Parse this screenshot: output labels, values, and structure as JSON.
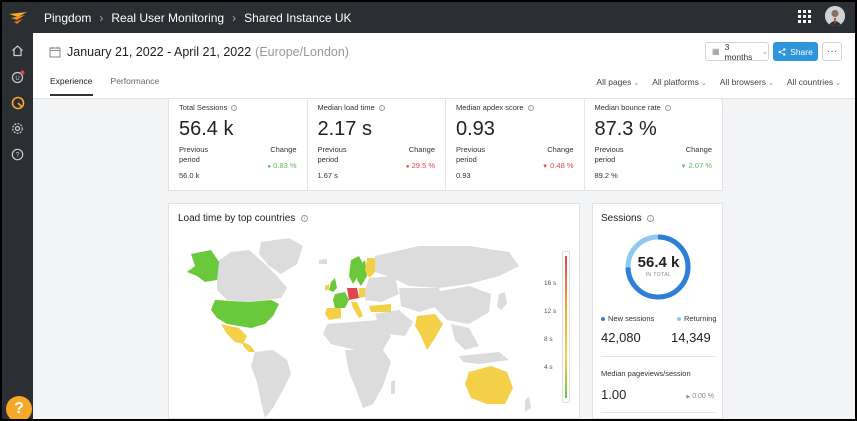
{
  "topbar": {
    "breadcrumbs": [
      "Pingdom",
      "Real User Monitoring",
      "Shared Instance UK"
    ]
  },
  "header": {
    "date_range": "January 21, 2022 - April 21, 2022",
    "timezone": "(Europe/London)",
    "period_label": "3 months",
    "share_label": "Share",
    "more_label": "···"
  },
  "tabs": [
    {
      "label": "Experience",
      "active": true
    },
    {
      "label": "Performance",
      "active": false
    }
  ],
  "filters": [
    "All pages",
    "All platforms",
    "All browsers",
    "All countries"
  ],
  "metrics": [
    {
      "title": "Total Sessions",
      "value": "56.4 k",
      "prev_label": "Previous period",
      "change_label": "Change",
      "change": "0.83 %",
      "trend": "up",
      "prev_value": "56.0 k"
    },
    {
      "title": "Median load time",
      "value": "2.17 s",
      "prev_label": "Previous period",
      "change_label": "Change",
      "change": "29.5 %",
      "trend": "up-bad",
      "prev_value": "1.67 s"
    },
    {
      "title": "Median apdex score",
      "value": "0.93",
      "prev_label": "Previous period",
      "change_label": "Change",
      "change": "0.48 %",
      "trend": "down-bad",
      "prev_value": "0.93"
    },
    {
      "title": "Median bounce rate",
      "value": "87.3 %",
      "prev_label": "Previous period",
      "change_label": "Change",
      "change": "2.07 %",
      "trend": "down-good",
      "prev_value": "89.2 %"
    }
  ],
  "map": {
    "title": "Load time by top countries",
    "legend_ticks": [
      "16 s",
      "12 s",
      "8 s",
      "4 s"
    ]
  },
  "sessions": {
    "title": "Sessions",
    "total": "56.4 k",
    "total_sub": "IN TOTAL",
    "new_label": "New sessions",
    "returning_label": "Returning",
    "new_value": "42,080",
    "returning_value": "14,349",
    "new_fraction": 0.746,
    "pageviews_label": "Median pageviews/session",
    "pageviews_value": "1.00",
    "pageviews_change": "0.00 %"
  },
  "colors": {
    "accent": "#2f95db",
    "new_sessions": "#2f7ed8",
    "returning": "#8ec9f0",
    "good": "#5cb85c",
    "bad": "#e0454b"
  }
}
